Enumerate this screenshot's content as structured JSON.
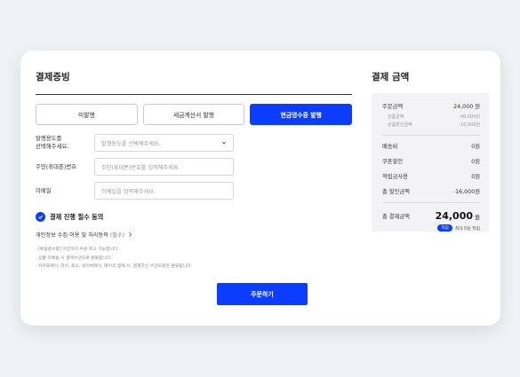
{
  "receipt": {
    "title": "결제증빙",
    "tabs": [
      {
        "label": "미발행"
      },
      {
        "label": "세금계산서 발행"
      },
      {
        "label": "현금영수증 발행"
      }
    ],
    "fields": {
      "purpose": {
        "label_line1": "발행용도를",
        "label_line2": "선택해주세요.",
        "placeholder": "발행용도를 선택해주세요."
      },
      "id": {
        "label": "주민(휴대폰)번호",
        "placeholder": "주민(휴대폰)번호를 입력해주세요."
      },
      "email": {
        "label": "이메일",
        "placeholder": "이메일을 입력해주세요."
      }
    },
    "agree": {
      "label": "결제 진행 필수 동의"
    },
    "privacy": {
      "label": "개인정보 수집·이용 및 처리동의",
      "required": "(필수)"
    },
    "notes": [
      "· [배송준비중] 이전까지 주문 취소 가능합니다.",
      "· 상품 미배송 시 결제수단으로 환불됩니다.",
      "· 카카오페이, 하이, 토스, 네이버페이, 페이코 결제 시, 결제하신 수단으로만 환불됩니다."
    ],
    "order_button": "주문하기"
  },
  "payment": {
    "title": "결제 금액",
    "order_amount": {
      "label": "주문금액",
      "value": "24,000 원"
    },
    "product_amount": {
      "label": "상품금액",
      "value": "40,000원"
    },
    "product_discount": {
      "label": "상품할인금액",
      "value": "-16,000원"
    },
    "shipping": {
      "label": "배송비",
      "value": "0원"
    },
    "coupon": {
      "label": "쿠폰할인",
      "value": "0원"
    },
    "reward": {
      "label": "적립금사용",
      "value": "0원"
    },
    "total_discount": {
      "label": "총 할인금액",
      "value": "-16,000원"
    },
    "total": {
      "label": "총 결제금액",
      "value": "24,000",
      "unit": "원"
    },
    "point": {
      "badge": "적립",
      "text": "최대 0원 적립"
    }
  },
  "colors": {
    "accent": "#0a3dff",
    "background": "#f1f2f5"
  }
}
